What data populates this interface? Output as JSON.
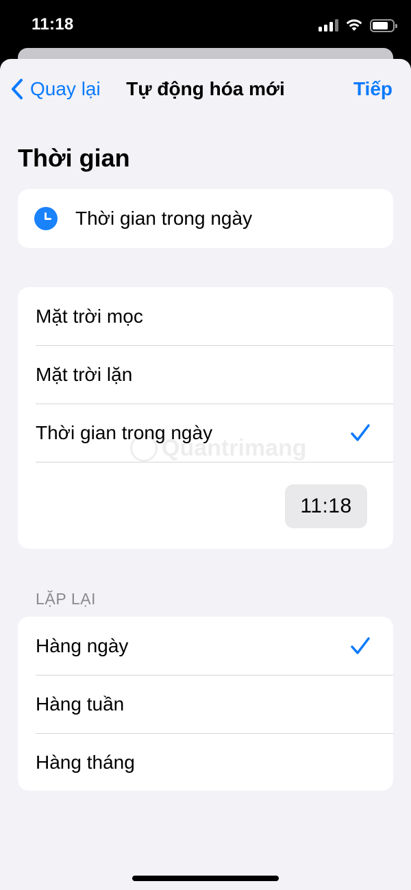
{
  "status_bar": {
    "time": "11:18",
    "icons": [
      "cellular-signal-icon",
      "wifi-icon",
      "battery-icon"
    ],
    "battery_level": 0.8
  },
  "nav": {
    "back_label": "Quay lại",
    "title": "Tự động hóa mới",
    "next_label": "Tiếp",
    "accent_color": "#0a7aff"
  },
  "section_title": "Thời gian",
  "trigger": {
    "label": "Thời gian trong ngày",
    "icon": "clock-icon"
  },
  "time_options": [
    {
      "label": "Mặt trời mọc",
      "selected": false
    },
    {
      "label": "Mặt trời lặn",
      "selected": false
    },
    {
      "label": "Thời gian trong ngày",
      "selected": true
    }
  ],
  "selected_time": "11:18",
  "repeat": {
    "label": "LẶP LẠI",
    "options": [
      {
        "label": "Hàng ngày",
        "selected": true
      },
      {
        "label": "Hàng tuần",
        "selected": false
      },
      {
        "label": "Hàng tháng",
        "selected": false
      }
    ]
  },
  "watermark": "Quantrimang"
}
